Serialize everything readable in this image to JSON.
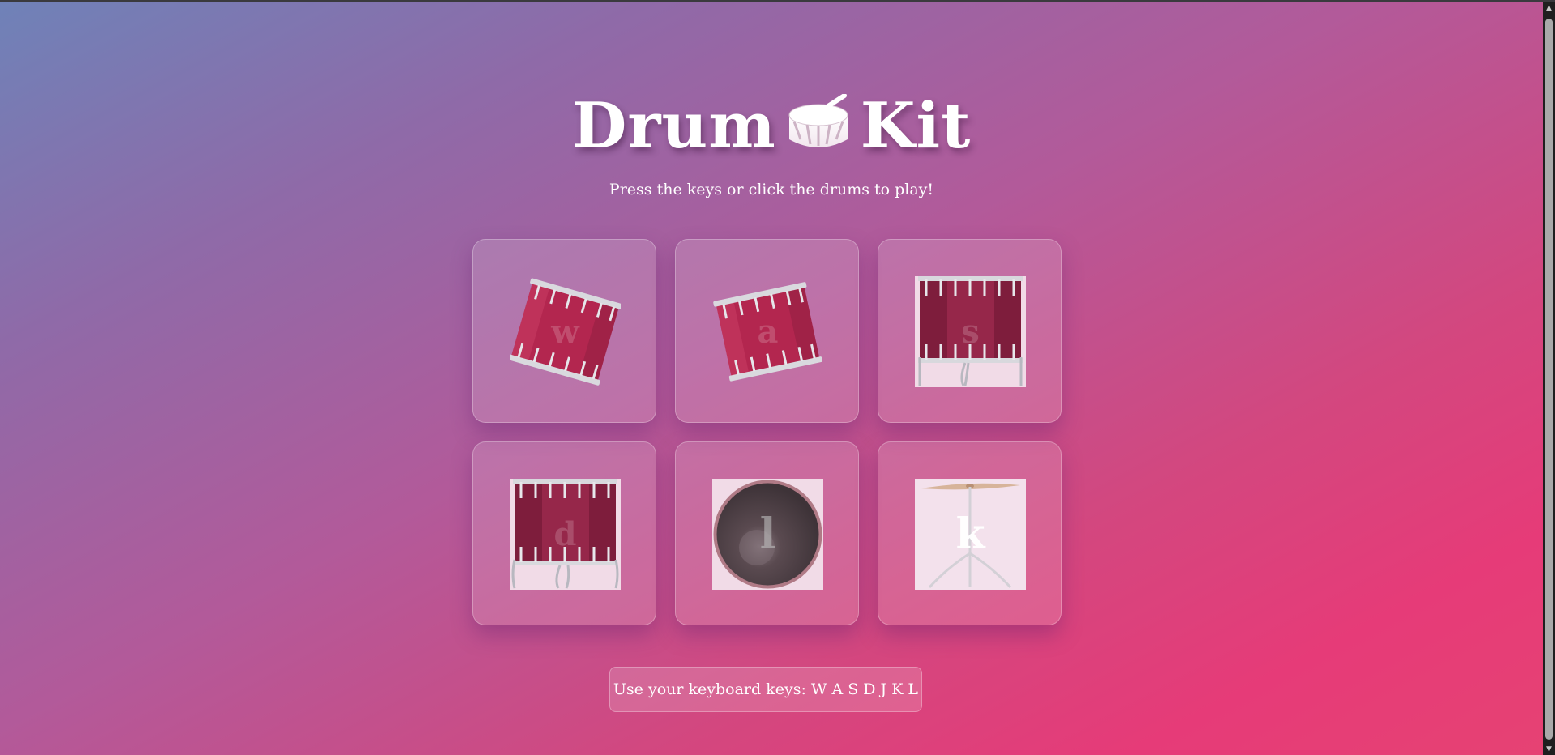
{
  "header": {
    "title_left": "Drum",
    "title_right": "Kit",
    "title_icon": "drum-icon",
    "subtitle": "Press the keys or click the drums to play!"
  },
  "pads": [
    {
      "key": "w",
      "icon": "snare-drum-icon"
    },
    {
      "key": "a",
      "icon": "snare-drum-icon"
    },
    {
      "key": "s",
      "icon": "tom-drum-icon"
    },
    {
      "key": "d",
      "icon": "floor-tom-icon"
    },
    {
      "key": "l",
      "icon": "kick-drum-icon"
    },
    {
      "key": "k",
      "icon": "cymbal-icon"
    }
  ],
  "footer": {
    "hint": "Use your keyboard keys: W A S D J K L"
  },
  "colors": {
    "gradient_start": "#6f82b8",
    "gradient_end": "#e63b78",
    "drum_red": "#b3264f",
    "text": "#ffffff"
  }
}
